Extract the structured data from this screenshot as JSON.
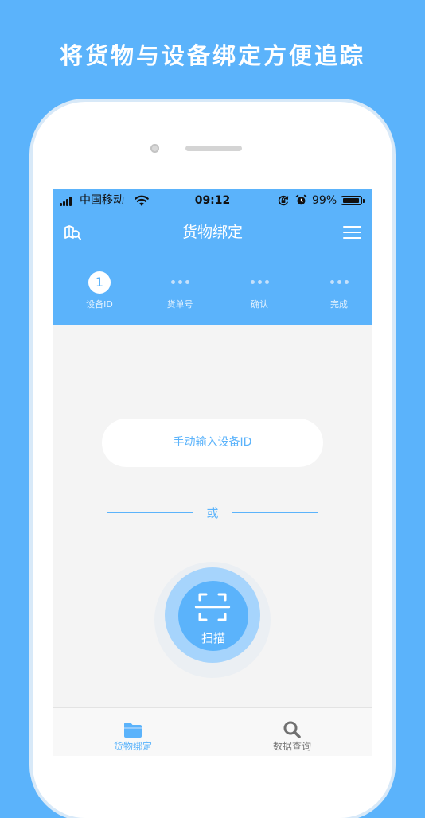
{
  "headline": "将货物与设备绑定方便追踪",
  "status_bar": {
    "carrier": "中国移动",
    "time": "09:12",
    "battery": "99%",
    "battery_level": 0.99
  },
  "nav": {
    "title": "货物绑定",
    "left_icon": "book-search-icon",
    "right_icon": "menu-icon"
  },
  "steps": [
    {
      "marker": "1",
      "label": "设备ID",
      "active": true
    },
    {
      "marker": "",
      "label": "货单号",
      "active": false
    },
    {
      "marker": "",
      "label": "确认",
      "active": false
    },
    {
      "marker": "",
      "label": "完成",
      "active": false
    }
  ],
  "main": {
    "manual_button": "手动输入设备ID",
    "or_text": "或",
    "scan_label": "扫描",
    "scan_icon": "scan-icon"
  },
  "tabs": [
    {
      "label": "货物绑定",
      "icon": "folder-icon",
      "active": true
    },
    {
      "label": "数据查询",
      "icon": "search-icon",
      "active": false
    }
  ],
  "colors": {
    "brand": "#5bb3fb",
    "light_ring": "#a6d4fc",
    "background": "#f4f4f4",
    "inactive_tab": "#777777"
  }
}
